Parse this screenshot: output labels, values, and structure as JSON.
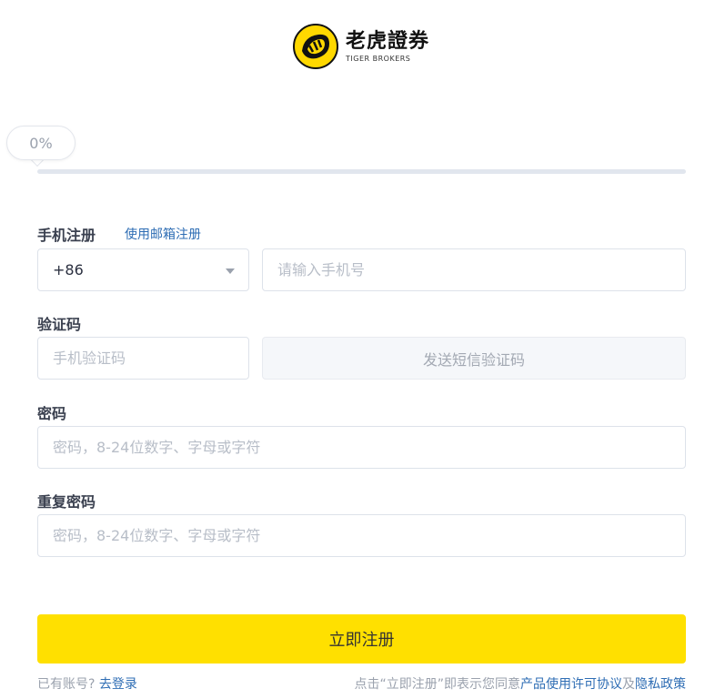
{
  "brand": {
    "name_cn": "老虎證券",
    "name_en": "TIGER BROKERS",
    "colors": {
      "primary": "#ffe000",
      "link": "#2e6db4",
      "text": "#3b4150"
    }
  },
  "progress": {
    "label": "0%",
    "value": 0
  },
  "phone": {
    "label": "手机注册",
    "switch_link": "使用邮箱注册",
    "country_code": "+86",
    "placeholder": "请输入手机号",
    "dropdown_icon": "chevron-down-icon"
  },
  "code": {
    "label": "验证码",
    "placeholder": "手机验证码",
    "send_button": "发送短信验证码"
  },
  "password": {
    "label": "密码",
    "placeholder": "密码，8-24位数字、字母或字符"
  },
  "repeat_password": {
    "label": "重复密码",
    "placeholder": "密码，8-24位数字、字母或字符"
  },
  "submit": {
    "label": "立即注册"
  },
  "footer": {
    "has_account": "已有账号?",
    "login_link": "去登录",
    "agree_prefix": "点击“立即注册”即表示您同意",
    "license_link": "产品使用许可协议",
    "and": "及",
    "privacy_link": "隐私政策"
  }
}
